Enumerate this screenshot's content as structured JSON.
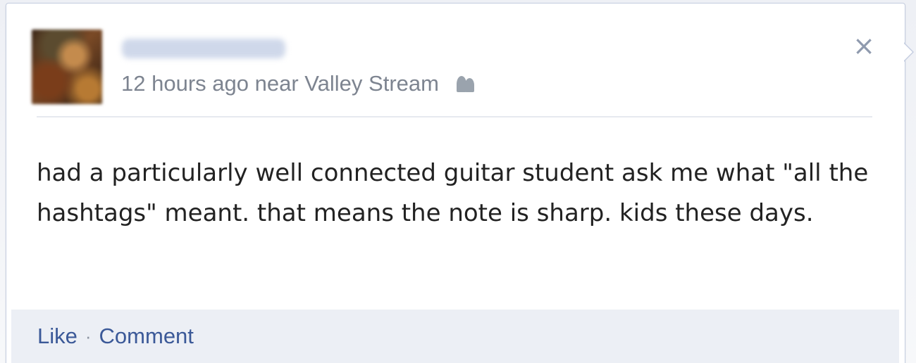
{
  "post": {
    "author_name": "",
    "timestamp": "12 hours ago",
    "location_prefix": "near",
    "location": "Valley Stream",
    "audience_icon": "friends-icon",
    "body": "had a particularly well connected guitar student ask me what \"all the hashtags\" meant. that means the note is sharp. kids these days."
  },
  "actions": {
    "like_label": "Like",
    "separator": "·",
    "comment_label": "Comment"
  },
  "close": {
    "icon": "close-icon",
    "symbol": "×"
  },
  "colors": {
    "link": "#3b5998",
    "meta": "#7d8490",
    "border": "#c4cde0",
    "actions_bg": "#eceff5"
  }
}
